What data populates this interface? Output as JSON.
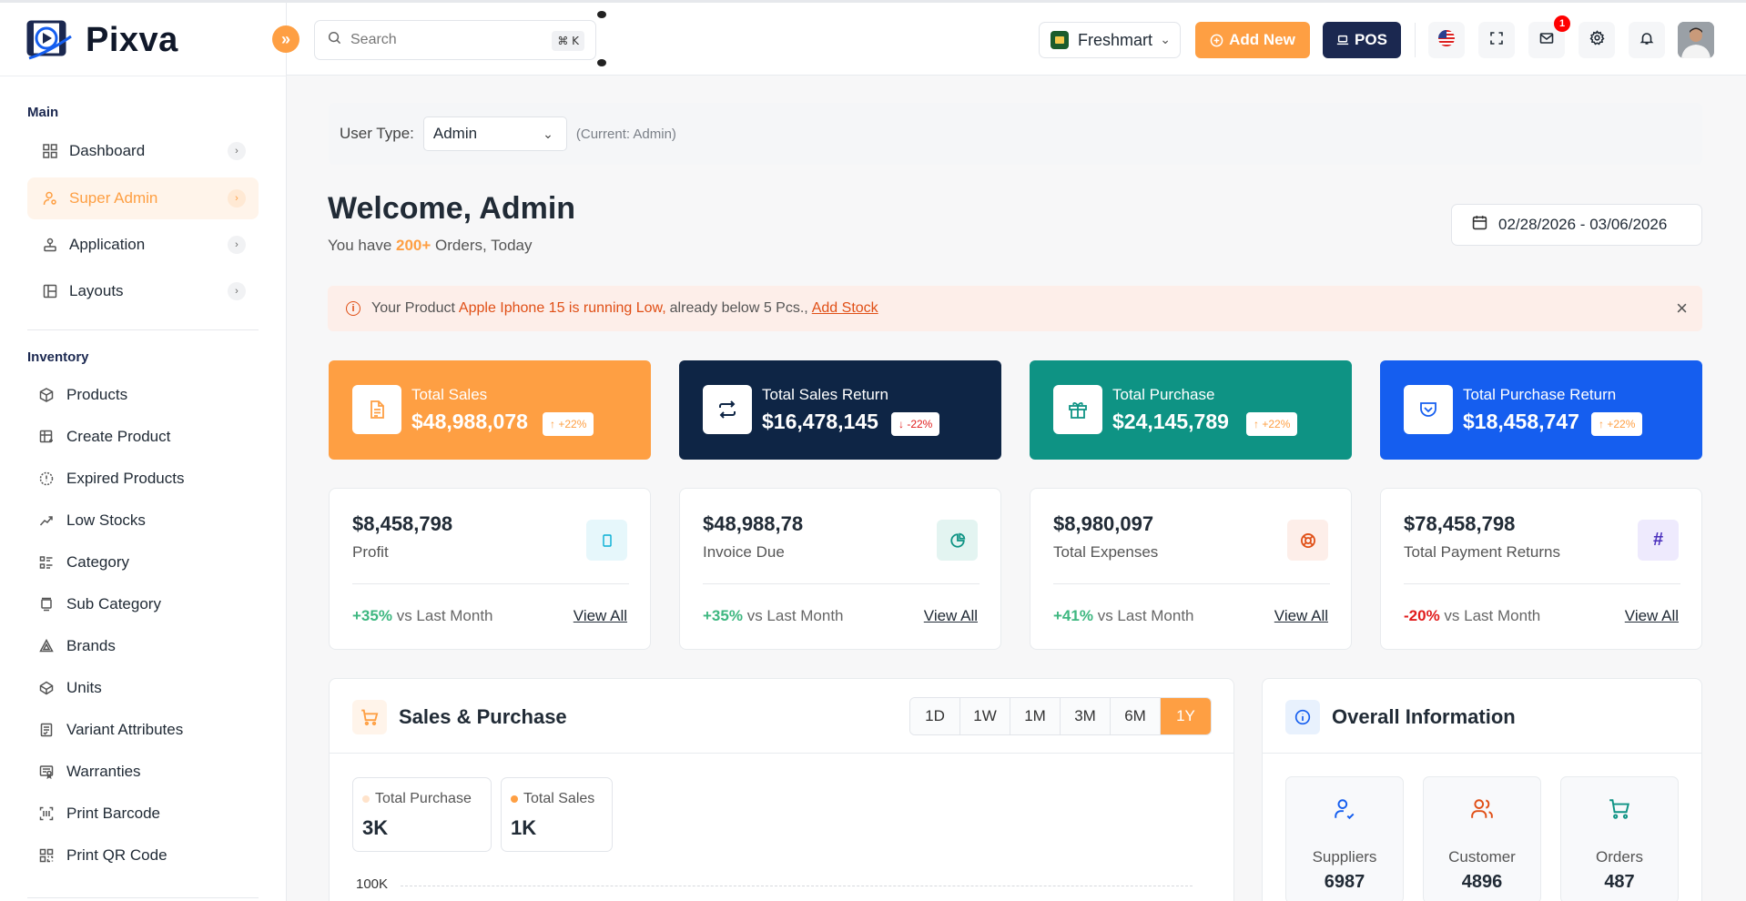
{
  "brand": {
    "name": "Pixva"
  },
  "sidebar": {
    "main_heading": "Main",
    "main_items": [
      {
        "label": "Dashboard",
        "icon": "grid-icon"
      },
      {
        "label": "Super Admin",
        "icon": "user-cog-icon",
        "active": true
      },
      {
        "label": "Application",
        "icon": "joystick-icon"
      },
      {
        "label": "Layouts",
        "icon": "layout-icon"
      }
    ],
    "inventory_heading": "Inventory",
    "inventory_items": [
      {
        "label": "Products",
        "icon": "box-icon"
      },
      {
        "label": "Create Product",
        "icon": "table-plus-icon"
      },
      {
        "label": "Expired Products",
        "icon": "progress-alert-icon"
      },
      {
        "label": "Low Stocks",
        "icon": "trending-down-icon"
      },
      {
        "label": "Category",
        "icon": "list-details-icon"
      },
      {
        "label": "Sub Category",
        "icon": "carousel-icon"
      },
      {
        "label": "Brands",
        "icon": "triangles-icon"
      },
      {
        "label": "Units",
        "icon": "brand-codepen-icon"
      },
      {
        "label": "Variant Attributes",
        "icon": "checklist-icon"
      },
      {
        "label": "Warranties",
        "icon": "certificate-icon"
      },
      {
        "label": "Print Barcode",
        "icon": "barcode-icon"
      },
      {
        "label": "Print QR Code",
        "icon": "qrcode-icon"
      }
    ]
  },
  "header": {
    "search_placeholder": "Search",
    "search_shortcut": "⌘ K",
    "store": "Freshmart",
    "add_new": "Add New",
    "pos": "POS",
    "mail_count": "1"
  },
  "usertype": {
    "label": "User Type:",
    "value": "Admin",
    "current": "(Current: Admin)"
  },
  "welcome": {
    "title": "Welcome, Admin",
    "prefix": "You have",
    "count": "200+",
    "suffix": "Orders, Today"
  },
  "daterange": "02/28/2026 - 03/06/2026",
  "alert": {
    "prefix": "Your Product",
    "product": "Apple Iphone 15 is running Low,",
    "middle": "already below 5 Pcs.,",
    "link": "Add Stock"
  },
  "stats": [
    {
      "label": "Total Sales",
      "value": "$48,988,078",
      "change": "↑ +22%",
      "color": "#fe9f43"
    },
    {
      "label": "Total Sales Return",
      "value": "$16,478,145",
      "change": "↓ -22%",
      "color": "#0e2545"
    },
    {
      "label": "Total Purchase",
      "value": "$24,145,789",
      "change": "↑ +22%",
      "color": "#0e9384"
    },
    {
      "label": "Total Purchase Return",
      "value": "$18,458,747",
      "change": "↑ +22%",
      "color": "#155eef"
    }
  ],
  "metrics": [
    {
      "value": "$8,458,798",
      "label": "Profit",
      "pct": "+35%",
      "vs": "vs Last Month",
      "view": "View All"
    },
    {
      "value": "$48,988,78",
      "label": "Invoice Due",
      "pct": "+35%",
      "vs": "vs Last Month",
      "view": "View All"
    },
    {
      "value": "$8,980,097",
      "label": "Total Expenses",
      "pct": "+41%",
      "vs": "vs Last Month",
      "view": "View All"
    },
    {
      "value": "$78,458,798",
      "label": "Total Payment Returns",
      "pct": "-20%",
      "vs": "vs Last Month",
      "view": "View All"
    }
  ],
  "sales_purchase": {
    "title": "Sales & Purchase",
    "ranges": [
      "1D",
      "1W",
      "1M",
      "3M",
      "6M",
      "1Y"
    ],
    "active_range": "1Y",
    "legend": [
      {
        "label": "Total Purchase",
        "value": "3K",
        "color": "#ffe3cb"
      },
      {
        "label": "Total Sales",
        "value": "1K",
        "color": "#fe9f43"
      }
    ],
    "y_top": "100K"
  },
  "overall": {
    "title": "Overall Information",
    "cards": [
      {
        "label": "Suppliers",
        "value": "6987"
      },
      {
        "label": "Customer",
        "value": "4896"
      },
      {
        "label": "Orders",
        "value": "487"
      }
    ]
  }
}
